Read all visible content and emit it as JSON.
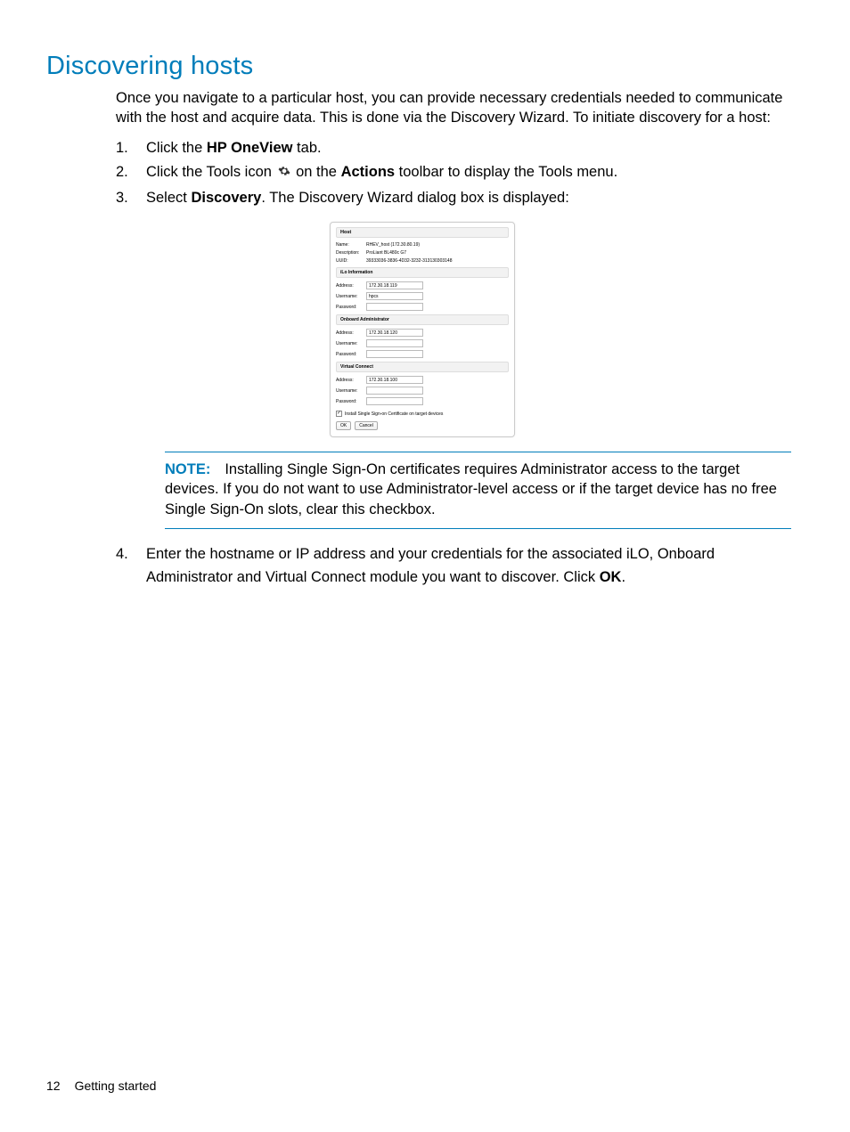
{
  "heading": "Discovering hosts",
  "intro": "Once you navigate to a particular host, you can provide necessary credentials needed to communicate with the host and acquire data. This is done via the Discovery Wizard. To initiate discovery for a host:",
  "steps": {
    "s1": {
      "num": "1.",
      "a": "Click the ",
      "b": "HP OneView",
      "c": " tab."
    },
    "s2": {
      "num": "2.",
      "a": "Click the Tools icon ",
      "b": "Actions",
      "c": " on the ",
      "d": " toolbar to display the Tools menu."
    },
    "s3": {
      "num": "3.",
      "a": "Select ",
      "b": "Discovery",
      "c": ". The Discovery Wizard dialog box is displayed:"
    },
    "s4": {
      "num": "4.",
      "a": "Enter the hostname or IP address and your credentials for the associated iLO, Onboard Administrator and Virtual Connect module you want to discover. Click ",
      "b": "OK",
      "c": "."
    }
  },
  "dialog": {
    "host_hdr": "Host",
    "name_lbl": "Name:",
    "name_val": "RHEV_host (172.30.80.19)",
    "desc_lbl": "Description:",
    "desc_val": "ProLiant BL480c G7",
    "uuid_lbl": "UUID:",
    "uuid_val": "39333036-3836-4D32-3232-313130303148",
    "ilo_hdr": "iLo Information",
    "oa_hdr": "Onboard Administrator",
    "vc_hdr": "Virtual Connect",
    "addr_lbl": "Address:",
    "user_lbl": "Username:",
    "pass_lbl": "Password:",
    "ilo_addr": "172.30.18.119",
    "ilo_user": "hpcs",
    "oa_addr": "172.30.18.120",
    "vc_addr": "172.30.18.100",
    "sso_label": "Install Single Sign-on Certificate on target devices",
    "ok_btn": "OK",
    "cancel_btn": "Cancel"
  },
  "note": {
    "label": "NOTE:",
    "text": "Installing Single Sign-On certificates requires Administrator access to the target devices. If you do not want to use Administrator-level access or if the target device has no free Single Sign-On slots, clear this checkbox."
  },
  "footer": {
    "page_num": "12",
    "section": "Getting started"
  }
}
